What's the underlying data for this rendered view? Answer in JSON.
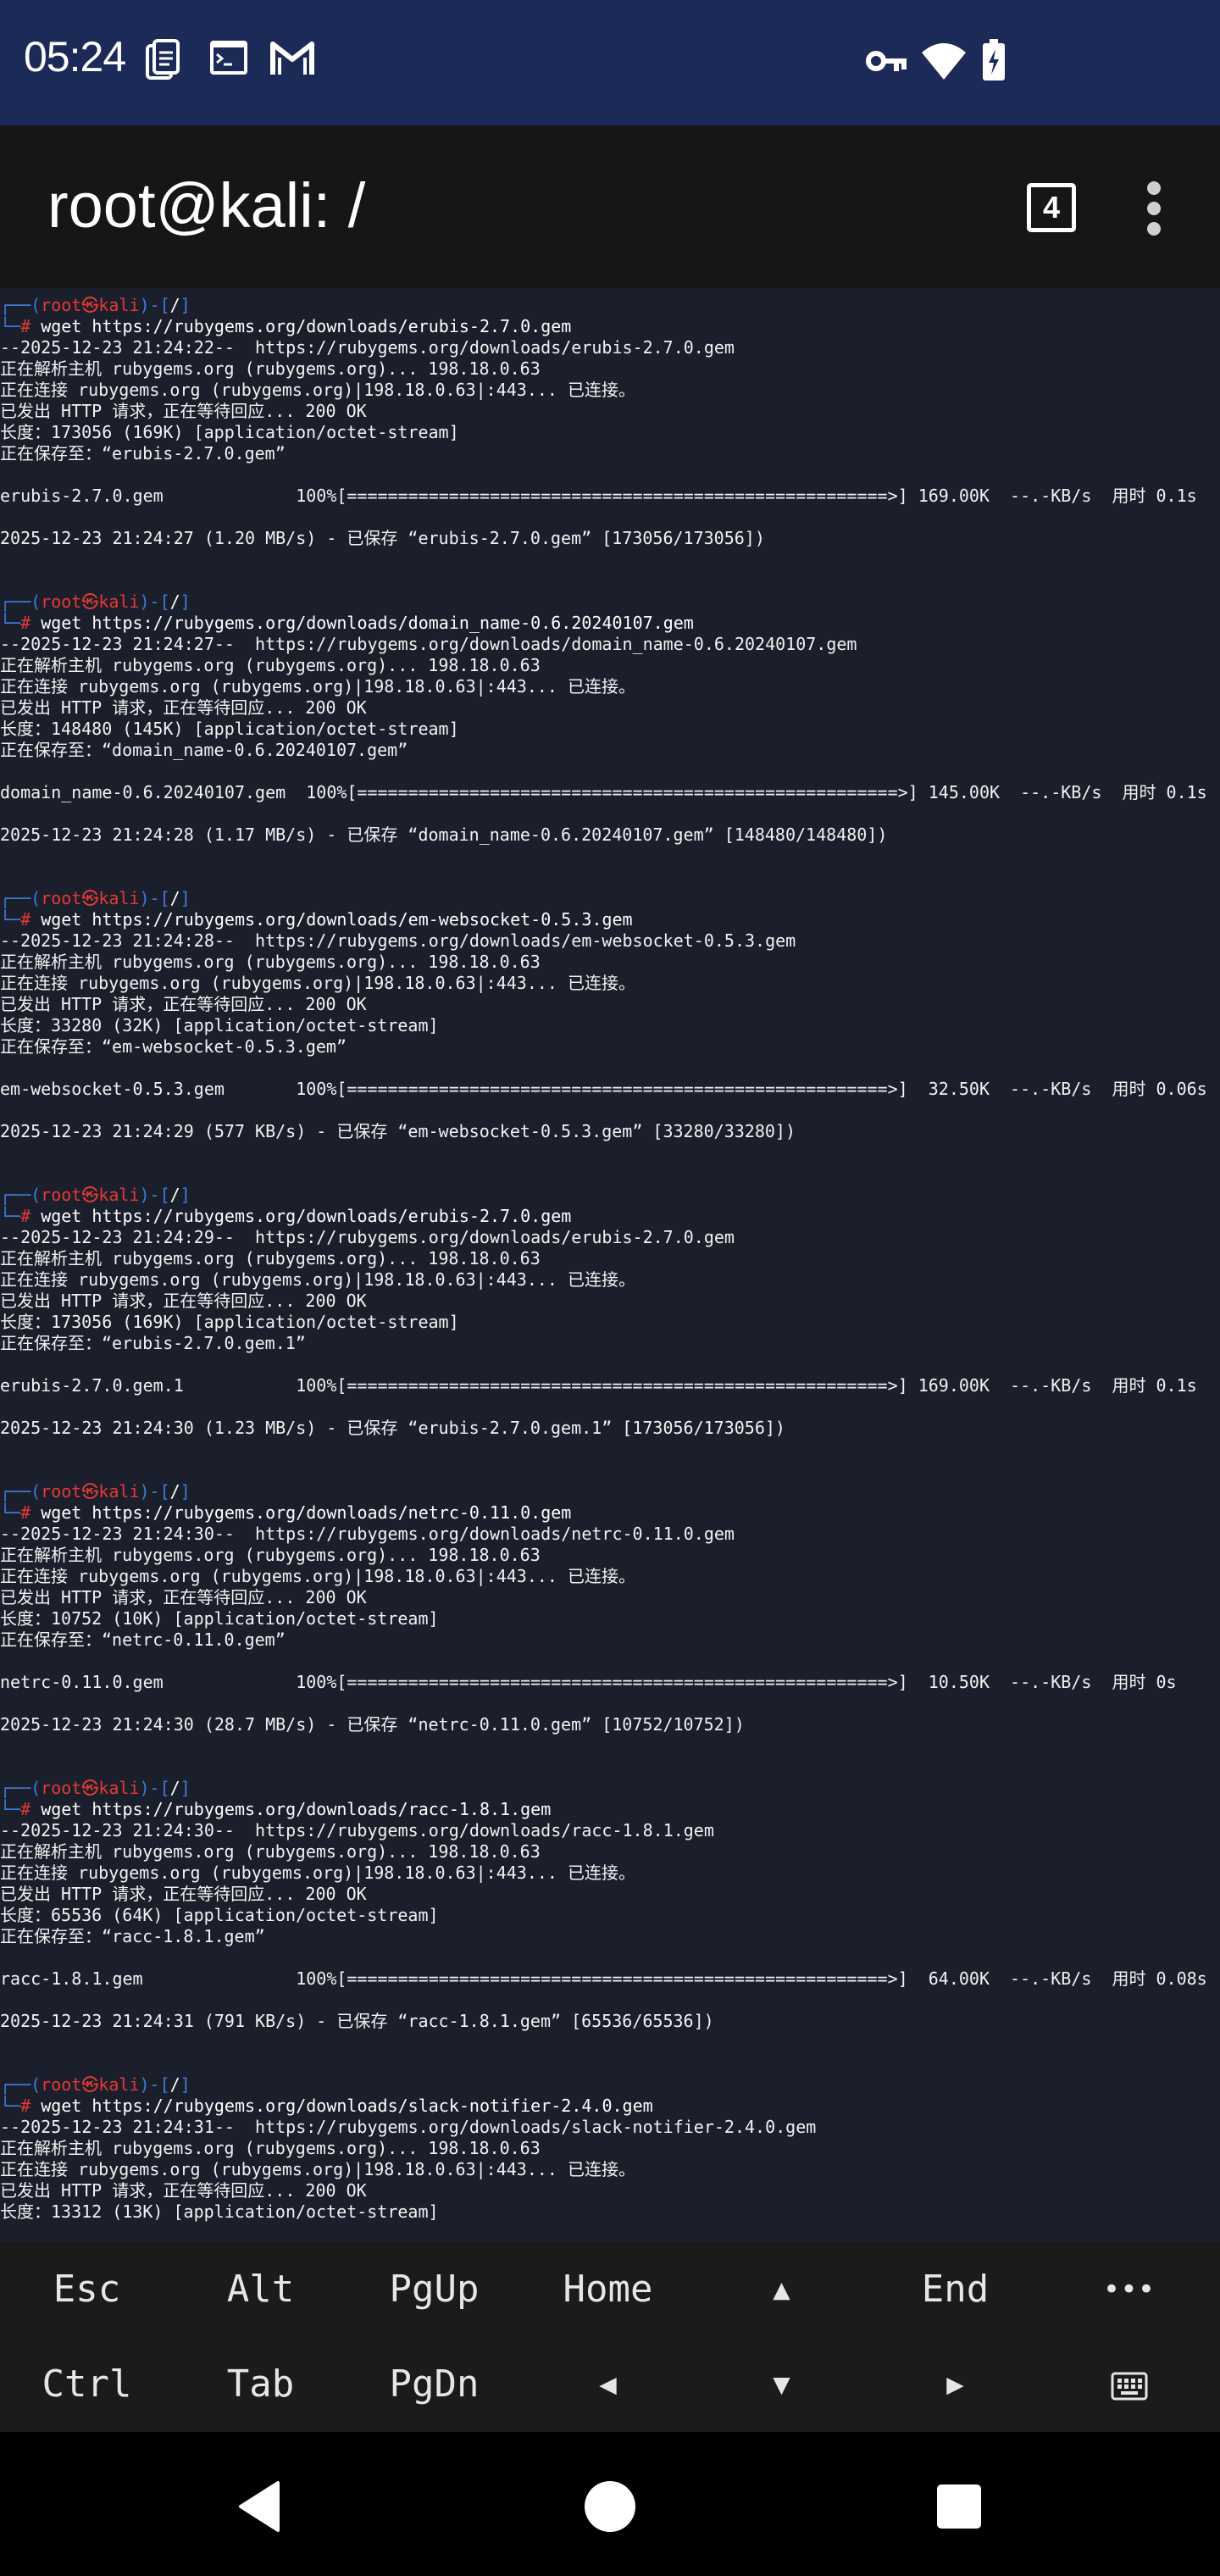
{
  "status_bar": {
    "time": "05:24",
    "left_icons": [
      "document-icon",
      "terminal-icon",
      "gmail-icon"
    ],
    "right_icons": [
      "vpn-key-icon",
      "wifi-icon",
      "battery-icon"
    ]
  },
  "app_bar": {
    "title": "root@kali: /",
    "session_count": "4",
    "menu_icon": "more-vert-icon"
  },
  "terminal": {
    "lines": [
      {
        "type": "prompt-top",
        "user": "root",
        "symbol": "㉿",
        "host": "kali",
        "cwd": "/"
      },
      {
        "type": "prompt-cmd",
        "cmd": "wget https://rubygems.org/downloads/erubis-2.7.0.gem"
      },
      {
        "type": "text",
        "text": "--2025-12-23 21:24:22--  https://rubygems.org/downloads/erubis-2.7.0.gem"
      },
      {
        "type": "text",
        "text": "正在解析主机 rubygems.org (rubygems.org)... 198.18.0.63"
      },
      {
        "type": "text",
        "text": "正在连接 rubygems.org (rubygems.org)|198.18.0.63|:443... 已连接。"
      },
      {
        "type": "text",
        "text": "已发出 HTTP 请求，正在等待回应... 200 OK"
      },
      {
        "type": "text",
        "text": "长度：173056 (169K) [application/octet-stream]"
      },
      {
        "type": "text",
        "text": "正在保存至：“erubis-2.7.0.gem”"
      },
      {
        "type": "text",
        "text": ""
      },
      {
        "type": "text",
        "text": "erubis-2.7.0.gem             100%[=====================================================>] 169.00K  --.-KB/s  用时 0.1s"
      },
      {
        "type": "text",
        "text": ""
      },
      {
        "type": "text",
        "text": "2025-12-23 21:24:27 (1.20 MB/s) - 已保存 “erubis-2.7.0.gem” [173056/173056])"
      },
      {
        "type": "text",
        "text": ""
      },
      {
        "type": "text",
        "text": ""
      },
      {
        "type": "prompt-top",
        "user": "root",
        "symbol": "㉿",
        "host": "kali",
        "cwd": "/"
      },
      {
        "type": "prompt-cmd",
        "cmd": "wget https://rubygems.org/downloads/domain_name-0.6.20240107.gem"
      },
      {
        "type": "text",
        "text": "--2025-12-23 21:24:27--  https://rubygems.org/downloads/domain_name-0.6.20240107.gem"
      },
      {
        "type": "text",
        "text": "正在解析主机 rubygems.org (rubygems.org)... 198.18.0.63"
      },
      {
        "type": "text",
        "text": "正在连接 rubygems.org (rubygems.org)|198.18.0.63|:443... 已连接。"
      },
      {
        "type": "text",
        "text": "已发出 HTTP 请求，正在等待回应... 200 OK"
      },
      {
        "type": "text",
        "text": "长度：148480 (145K) [application/octet-stream]"
      },
      {
        "type": "text",
        "text": "正在保存至：“domain_name-0.6.20240107.gem”"
      },
      {
        "type": "text",
        "text": ""
      },
      {
        "type": "text",
        "text": "domain_name-0.6.20240107.gem  100%[=====================================================>] 145.00K  --.-KB/s  用时 0.1s"
      },
      {
        "type": "text",
        "text": ""
      },
      {
        "type": "text",
        "text": "2025-12-23 21:24:28 (1.17 MB/s) - 已保存 “domain_name-0.6.20240107.gem” [148480/148480])"
      },
      {
        "type": "text",
        "text": ""
      },
      {
        "type": "text",
        "text": ""
      },
      {
        "type": "prompt-top",
        "user": "root",
        "symbol": "㉿",
        "host": "kali",
        "cwd": "/"
      },
      {
        "type": "prompt-cmd",
        "cmd": "wget https://rubygems.org/downloads/em-websocket-0.5.3.gem"
      },
      {
        "type": "text",
        "text": "--2025-12-23 21:24:28--  https://rubygems.org/downloads/em-websocket-0.5.3.gem"
      },
      {
        "type": "text",
        "text": "正在解析主机 rubygems.org (rubygems.org)... 198.18.0.63"
      },
      {
        "type": "text",
        "text": "正在连接 rubygems.org (rubygems.org)|198.18.0.63|:443... 已连接。"
      },
      {
        "type": "text",
        "text": "已发出 HTTP 请求，正在等待回应... 200 OK"
      },
      {
        "type": "text",
        "text": "长度：33280 (32K) [application/octet-stream]"
      },
      {
        "type": "text",
        "text": "正在保存至：“em-websocket-0.5.3.gem”"
      },
      {
        "type": "text",
        "text": ""
      },
      {
        "type": "text",
        "text": "em-websocket-0.5.3.gem       100%[=====================================================>]  32.50K  --.-KB/s  用时 0.06s"
      },
      {
        "type": "text",
        "text": ""
      },
      {
        "type": "text",
        "text": "2025-12-23 21:24:29 (577 KB/s) - 已保存 “em-websocket-0.5.3.gem” [33280/33280])"
      },
      {
        "type": "text",
        "text": ""
      },
      {
        "type": "text",
        "text": ""
      },
      {
        "type": "prompt-top",
        "user": "root",
        "symbol": "㉿",
        "host": "kali",
        "cwd": "/"
      },
      {
        "type": "prompt-cmd",
        "cmd": "wget https://rubygems.org/downloads/erubis-2.7.0.gem"
      },
      {
        "type": "text",
        "text": "--2025-12-23 21:24:29--  https://rubygems.org/downloads/erubis-2.7.0.gem"
      },
      {
        "type": "text",
        "text": "正在解析主机 rubygems.org (rubygems.org)... 198.18.0.63"
      },
      {
        "type": "text",
        "text": "正在连接 rubygems.org (rubygems.org)|198.18.0.63|:443... 已连接。"
      },
      {
        "type": "text",
        "text": "已发出 HTTP 请求，正在等待回应... 200 OK"
      },
      {
        "type": "text",
        "text": "长度：173056 (169K) [application/octet-stream]"
      },
      {
        "type": "text",
        "text": "正在保存至：“erubis-2.7.0.gem.1”"
      },
      {
        "type": "text",
        "text": ""
      },
      {
        "type": "text",
        "text": "erubis-2.7.0.gem.1           100%[=====================================================>] 169.00K  --.-KB/s  用时 0.1s"
      },
      {
        "type": "text",
        "text": ""
      },
      {
        "type": "text",
        "text": "2025-12-23 21:24:30 (1.23 MB/s) - 已保存 “erubis-2.7.0.gem.1” [173056/173056])"
      },
      {
        "type": "text",
        "text": ""
      },
      {
        "type": "text",
        "text": ""
      },
      {
        "type": "prompt-top",
        "user": "root",
        "symbol": "㉿",
        "host": "kali",
        "cwd": "/"
      },
      {
        "type": "prompt-cmd",
        "cmd": "wget https://rubygems.org/downloads/netrc-0.11.0.gem"
      },
      {
        "type": "text",
        "text": "--2025-12-23 21:24:30--  https://rubygems.org/downloads/netrc-0.11.0.gem"
      },
      {
        "type": "text",
        "text": "正在解析主机 rubygems.org (rubygems.org)... 198.18.0.63"
      },
      {
        "type": "text",
        "text": "正在连接 rubygems.org (rubygems.org)|198.18.0.63|:443... 已连接。"
      },
      {
        "type": "text",
        "text": "已发出 HTTP 请求，正在等待回应... 200 OK"
      },
      {
        "type": "text",
        "text": "长度：10752 (10K) [application/octet-stream]"
      },
      {
        "type": "text",
        "text": "正在保存至：“netrc-0.11.0.gem”"
      },
      {
        "type": "text",
        "text": ""
      },
      {
        "type": "text",
        "text": "netrc-0.11.0.gem             100%[=====================================================>]  10.50K  --.-KB/s  用时 0s"
      },
      {
        "type": "text",
        "text": ""
      },
      {
        "type": "text",
        "text": "2025-12-23 21:24:30 (28.7 MB/s) - 已保存 “netrc-0.11.0.gem” [10752/10752])"
      },
      {
        "type": "text",
        "text": ""
      },
      {
        "type": "text",
        "text": ""
      },
      {
        "type": "prompt-top",
        "user": "root",
        "symbol": "㉿",
        "host": "kali",
        "cwd": "/"
      },
      {
        "type": "prompt-cmd",
        "cmd": "wget https://rubygems.org/downloads/racc-1.8.1.gem"
      },
      {
        "type": "text",
        "text": "--2025-12-23 21:24:30--  https://rubygems.org/downloads/racc-1.8.1.gem"
      },
      {
        "type": "text",
        "text": "正在解析主机 rubygems.org (rubygems.org)... 198.18.0.63"
      },
      {
        "type": "text",
        "text": "正在连接 rubygems.org (rubygems.org)|198.18.0.63|:443... 已连接。"
      },
      {
        "type": "text",
        "text": "已发出 HTTP 请求，正在等待回应... 200 OK"
      },
      {
        "type": "text",
        "text": "长度：65536 (64K) [application/octet-stream]"
      },
      {
        "type": "text",
        "text": "正在保存至：“racc-1.8.1.gem”"
      },
      {
        "type": "text",
        "text": ""
      },
      {
        "type": "text",
        "text": "racc-1.8.1.gem               100%[=====================================================>]  64.00K  --.-KB/s  用时 0.08s"
      },
      {
        "type": "text",
        "text": ""
      },
      {
        "type": "text",
        "text": "2025-12-23 21:24:31 (791 KB/s) - 已保存 “racc-1.8.1.gem” [65536/65536])"
      },
      {
        "type": "text",
        "text": ""
      },
      {
        "type": "text",
        "text": ""
      },
      {
        "type": "prompt-top",
        "user": "root",
        "symbol": "㉿",
        "host": "kali",
        "cwd": "/"
      },
      {
        "type": "prompt-cmd",
        "cmd": "wget https://rubygems.org/downloads/slack-notifier-2.4.0.gem"
      },
      {
        "type": "text",
        "text": "--2025-12-23 21:24:31--  https://rubygems.org/downloads/slack-notifier-2.4.0.gem"
      },
      {
        "type": "text",
        "text": "正在解析主机 rubygems.org (rubygems.org)... 198.18.0.63"
      },
      {
        "type": "text",
        "text": "正在连接 rubygems.org (rubygems.org)|198.18.0.63|:443... 已连接。"
      },
      {
        "type": "text",
        "text": "已发出 HTTP 请求，正在等待回应... 200 OK"
      },
      {
        "type": "text",
        "text": "长度：13312 (13K) [application/octet-stream]"
      }
    ]
  },
  "extra_keys": {
    "row1": [
      "Esc",
      "Alt",
      "PgUp",
      "Home",
      "▲",
      "End",
      "•••"
    ],
    "row2": [
      "Ctrl",
      "Tab",
      "PgDn",
      "◀",
      "▼",
      "▶",
      "keyboard-icon"
    ]
  },
  "nav_bar": {
    "buttons": [
      "back-icon",
      "home-icon",
      "recents-icon"
    ]
  },
  "colors": {
    "status_bar": "#1c2a58",
    "app_bar": "#161616",
    "terminal_bg": "#1b1f2b",
    "prompt_frame": "#3f7bd8",
    "prompt_user": "#e53935",
    "extra_keys_bg": "#1b1b1b"
  }
}
